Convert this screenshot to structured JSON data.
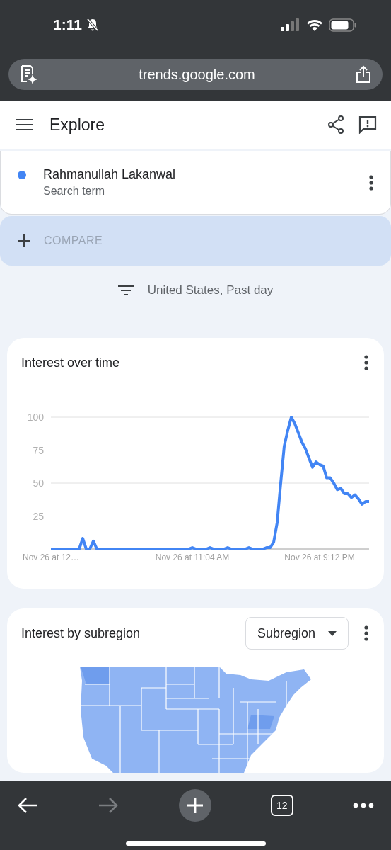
{
  "status_bar": {
    "time": "1:11"
  },
  "browser": {
    "url": "trends.google.com"
  },
  "header": {
    "title": "Explore"
  },
  "search_terms": [
    {
      "name": "Rahmanullah Lakanwal",
      "subtitle": "Search term",
      "color": "#4285f4"
    }
  ],
  "compare": {
    "label": "COMPARE"
  },
  "filter": {
    "label": "United States, Past day"
  },
  "interest_over_time": {
    "title": "Interest over time",
    "chart_data": {
      "type": "line",
      "grid": true,
      "categories": [
        "Nov 26 at 12…",
        null,
        null,
        null,
        null,
        null,
        null,
        null,
        null,
        null,
        null,
        null,
        null,
        null,
        null,
        null,
        null,
        null,
        null,
        null,
        null,
        null,
        null,
        null,
        null,
        null,
        null,
        null,
        null,
        null,
        null,
        null,
        null,
        null,
        null,
        null,
        null,
        null,
        null,
        null,
        "Nov 26 at 11:04 AM",
        null,
        null,
        null,
        null,
        null,
        null,
        null,
        null,
        null,
        null,
        null,
        null,
        null,
        null,
        null,
        null,
        null,
        null,
        null,
        null,
        null,
        null,
        null,
        null,
        null,
        null,
        null,
        null,
        null,
        null,
        null,
        null,
        null,
        null,
        null,
        "Nov 26 at 9:12 PM",
        null,
        null,
        null,
        null,
        null,
        null,
        null,
        null,
        null,
        null,
        null,
        null,
        null,
        null
      ],
      "ylim": [
        0,
        100
      ],
      "yticks": [
        25,
        50,
        75,
        100
      ],
      "series": [
        {
          "color": "#4285f4",
          "values": [
            0,
            0,
            0,
            0,
            0,
            0,
            0,
            0,
            0,
            8,
            0,
            0,
            6,
            0,
            0,
            0,
            0,
            0,
            0,
            0,
            0,
            0,
            0,
            0,
            0,
            0,
            0,
            0,
            0,
            0,
            0,
            0,
            0,
            0,
            0,
            0,
            0,
            0,
            0,
            0,
            1,
            0,
            0,
            0,
            0,
            1,
            0,
            0,
            0,
            0,
            1,
            0,
            0,
            0,
            0,
            0,
            1,
            0,
            0,
            0,
            0,
            1,
            1,
            5,
            20,
            50,
            78,
            90,
            100,
            95,
            88,
            81,
            76,
            69,
            62,
            66,
            64,
            63,
            54,
            54,
            50,
            45,
            46,
            42,
            42,
            39,
            41,
            38,
            34,
            36,
            36
          ]
        }
      ]
    }
  },
  "interest_by_subregion": {
    "title": "Interest by subregion",
    "dropdown": "Subregion"
  },
  "bottom_toolbar": {
    "forward_disabled": true,
    "tab_count": "12"
  }
}
